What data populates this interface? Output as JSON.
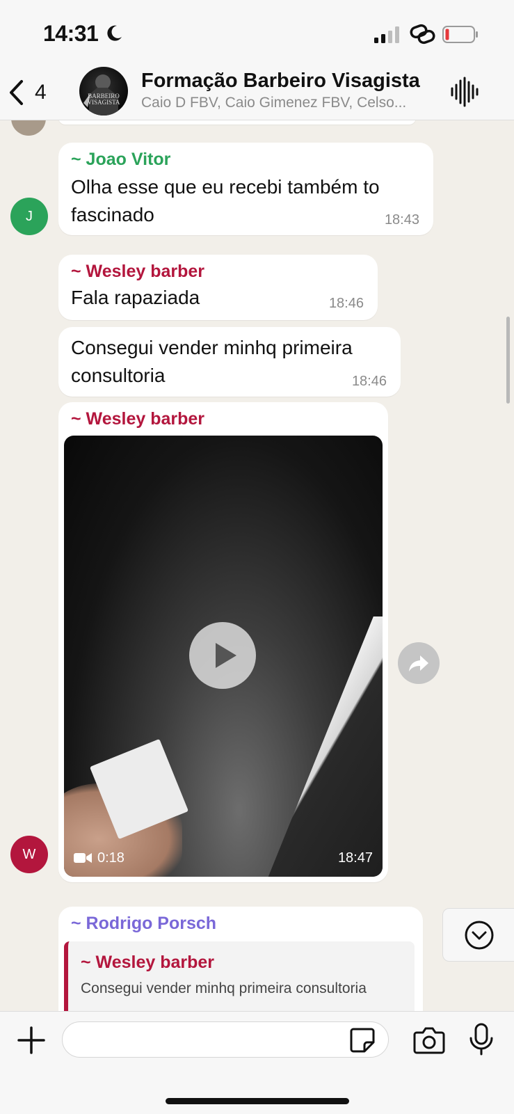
{
  "status_bar": {
    "time": "14:31"
  },
  "header": {
    "back_count": "4",
    "avatar_logo_text": "BARBEIRO VISAGISTA",
    "title": "Formação Barbeiro Visagista",
    "members": "Caio D FBV, Caio Gimenez FBV, Celso..."
  },
  "colors": {
    "joao": "#2ba35a",
    "wesley": "#b3163d",
    "rodrigo": "#7a68d8",
    "battery_low": "#e5383b"
  },
  "messages": [
    {
      "sender": "~ Joao Vitor",
      "text": "Olha esse que eu recebi  também to fascinado",
      "time": "18:43",
      "avatar_letter": "J"
    },
    {
      "sender": "~ Wesley barber",
      "text": "Fala rapaziada",
      "time": "18:46"
    },
    {
      "text": "Consegui vender minhq primeira consultoria",
      "time": "18:46"
    },
    {
      "sender": "~ Wesley barber",
      "type": "video",
      "duration": "0:18",
      "time": "18:47",
      "avatar_letter": "W"
    },
    {
      "sender": "~ Rodrigo Porsch",
      "quote": {
        "sender": "~ Wesley barber",
        "text": "Consegui vender minhq primeira consultoria"
      }
    }
  ],
  "input": {
    "placeholder": ""
  },
  "icons": [
    "back-chevron-icon",
    "moon-icon",
    "signal-icon",
    "link-icon",
    "battery-icon",
    "audio-wave-icon",
    "play-icon",
    "video-camera-icon",
    "forward-icon",
    "chevron-down-icon",
    "plus-icon",
    "sticker-icon",
    "camera-icon",
    "microphone-icon"
  ]
}
